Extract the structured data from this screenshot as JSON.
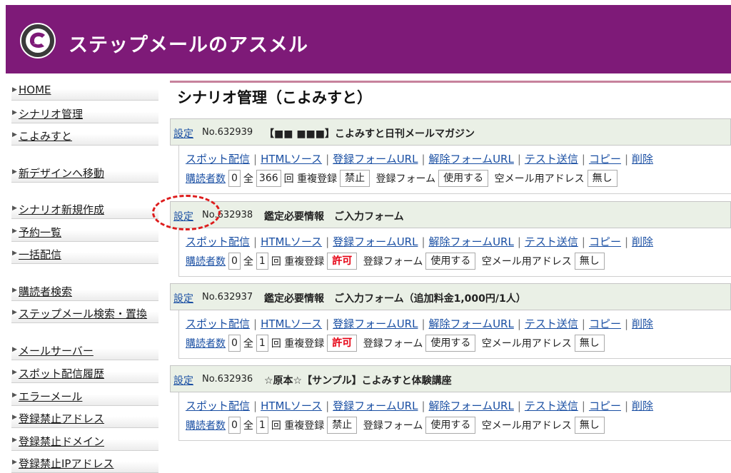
{
  "header": {
    "brand": "ステップメールのアスメル"
  },
  "sidebar": {
    "items": [
      {
        "label": "HOME"
      },
      {
        "label": "シナリオ管理"
      },
      {
        "label": "こよみすと"
      },
      {
        "label": "新デザインへ移動"
      },
      {
        "label": "シナリオ新規作成"
      },
      {
        "label": "予約一覧"
      },
      {
        "label": "一括配信"
      },
      {
        "label": "購読者検索"
      },
      {
        "label": "ステップメール検索・置換"
      },
      {
        "label": "メールサーバー"
      },
      {
        "label": "スポット配信履歴"
      },
      {
        "label": "エラーメール"
      },
      {
        "label": "登録禁止アドレス"
      },
      {
        "label": "登録禁止ドメイン"
      },
      {
        "label": "登録禁止IPアドレス"
      }
    ]
  },
  "main": {
    "title": "シナリオ管理（こよみすと）"
  },
  "common": {
    "setting": "設定",
    "links": [
      "スポット配信",
      "HTMLソース",
      "登録フォームURL",
      "解除フォームURL",
      "テスト送信",
      "コピー",
      "削除"
    ],
    "subscribers": "購読者数",
    "total": "全",
    "times": "回",
    "dup_label": "重複登録",
    "form_label": "登録フォーム",
    "form_value": "使用する",
    "empty_label": "空メール用アドレス",
    "empty_value": "無し"
  },
  "scenarios": [
    {
      "no": "No.632939",
      "title": "【■■ ■■■】こよみすと日刊メールマガジン",
      "subscribers": "0",
      "total": "366",
      "dup": "禁止"
    },
    {
      "no": "No.632938",
      "title": "鑑定必要情報　ご入力フォーム",
      "subscribers": "0",
      "total": "1",
      "dup": "許可"
    },
    {
      "no": "No.632937",
      "title": "鑑定必要情報　ご入力フォーム（追加料金1,000円/1人）",
      "subscribers": "0",
      "total": "1",
      "dup": "許可"
    },
    {
      "no": "No.632936",
      "title": "☆原本☆【サンプル】こよみすと体験講座",
      "subscribers": "0",
      "total": "1",
      "dup": "禁止"
    }
  ],
  "colors": {
    "header_bg": "#7e1a78",
    "link": "#1a4fa3",
    "allow": "#e60012",
    "callout": "#dd1c1c"
  }
}
